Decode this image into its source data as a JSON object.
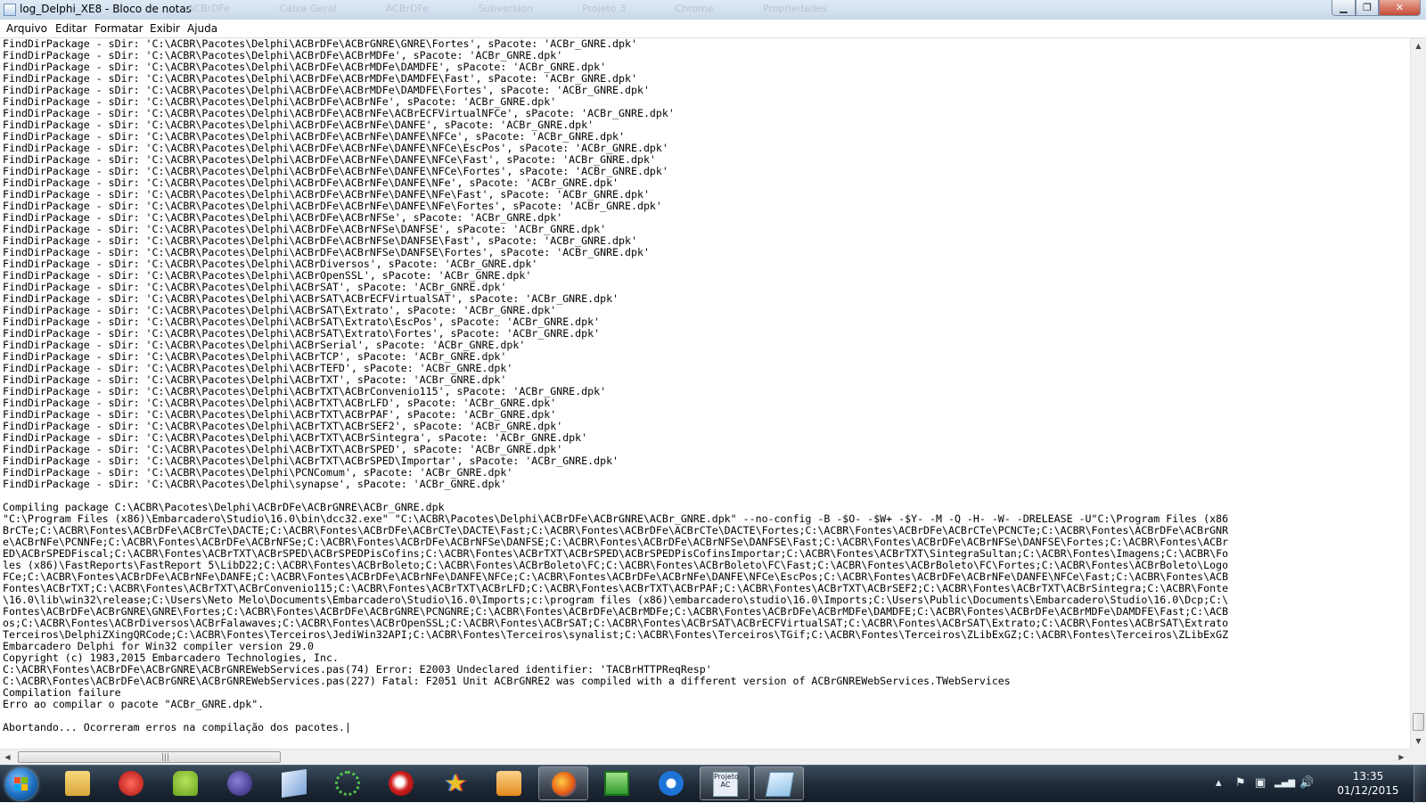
{
  "window": {
    "title": "log_Delphi_XE8 - Bloco de notas",
    "ghost_tabs": [
      "ACBrDFe",
      "Caixa Geral",
      "ACBrDFe",
      "Subversion",
      "Projeto 3",
      "Chrome",
      "Propriedades"
    ]
  },
  "window_buttons": {
    "minimize": "▁",
    "maximize": "❐",
    "close": "✕"
  },
  "menu": [
    "Arquivo",
    "Editar",
    "Formatar",
    "Exibir",
    "Ajuda"
  ],
  "content": {
    "lines": [
      "FindDirPackage - sDir: 'C:\\ACBR\\Pacotes\\Delphi\\ACBrDFe\\ACBrGNRE\\GNRE\\Fortes', sPacote: 'ACBr_GNRE.dpk'",
      "FindDirPackage - sDir: 'C:\\ACBR\\Pacotes\\Delphi\\ACBrDFe\\ACBrMDFe', sPacote: 'ACBr_GNRE.dpk'",
      "FindDirPackage - sDir: 'C:\\ACBR\\Pacotes\\Delphi\\ACBrDFe\\ACBrMDFe\\DAMDFE', sPacote: 'ACBr_GNRE.dpk'",
      "FindDirPackage - sDir: 'C:\\ACBR\\Pacotes\\Delphi\\ACBrDFe\\ACBrMDFe\\DAMDFE\\Fast', sPacote: 'ACBr_GNRE.dpk'",
      "FindDirPackage - sDir: 'C:\\ACBR\\Pacotes\\Delphi\\ACBrDFe\\ACBrMDFe\\DAMDFE\\Fortes', sPacote: 'ACBr_GNRE.dpk'",
      "FindDirPackage - sDir: 'C:\\ACBR\\Pacotes\\Delphi\\ACBrDFe\\ACBrNFe', sPacote: 'ACBr_GNRE.dpk'",
      "FindDirPackage - sDir: 'C:\\ACBR\\Pacotes\\Delphi\\ACBrDFe\\ACBrNFe\\ACBrECFVirtualNFCe', sPacote: 'ACBr_GNRE.dpk'",
      "FindDirPackage - sDir: 'C:\\ACBR\\Pacotes\\Delphi\\ACBrDFe\\ACBrNFe\\DANFE', sPacote: 'ACBr_GNRE.dpk'",
      "FindDirPackage - sDir: 'C:\\ACBR\\Pacotes\\Delphi\\ACBrDFe\\ACBrNFe\\DANFE\\NFCe', sPacote: 'ACBr_GNRE.dpk'",
      "FindDirPackage - sDir: 'C:\\ACBR\\Pacotes\\Delphi\\ACBrDFe\\ACBrNFe\\DANFE\\NFCe\\EscPos', sPacote: 'ACBr_GNRE.dpk'",
      "FindDirPackage - sDir: 'C:\\ACBR\\Pacotes\\Delphi\\ACBrDFe\\ACBrNFe\\DANFE\\NFCe\\Fast', sPacote: 'ACBr_GNRE.dpk'",
      "FindDirPackage - sDir: 'C:\\ACBR\\Pacotes\\Delphi\\ACBrDFe\\ACBrNFe\\DANFE\\NFCe\\Fortes', sPacote: 'ACBr_GNRE.dpk'",
      "FindDirPackage - sDir: 'C:\\ACBR\\Pacotes\\Delphi\\ACBrDFe\\ACBrNFe\\DANFE\\NFe', sPacote: 'ACBr_GNRE.dpk'",
      "FindDirPackage - sDir: 'C:\\ACBR\\Pacotes\\Delphi\\ACBrDFe\\ACBrNFe\\DANFE\\NFe\\Fast', sPacote: 'ACBr_GNRE.dpk'",
      "FindDirPackage - sDir: 'C:\\ACBR\\Pacotes\\Delphi\\ACBrDFe\\ACBrNFe\\DANFE\\NFe\\Fortes', sPacote: 'ACBr_GNRE.dpk'",
      "FindDirPackage - sDir: 'C:\\ACBR\\Pacotes\\Delphi\\ACBrDFe\\ACBrNFSe', sPacote: 'ACBr_GNRE.dpk'",
      "FindDirPackage - sDir: 'C:\\ACBR\\Pacotes\\Delphi\\ACBrDFe\\ACBrNFSe\\DANFSE', sPacote: 'ACBr_GNRE.dpk'",
      "FindDirPackage - sDir: 'C:\\ACBR\\Pacotes\\Delphi\\ACBrDFe\\ACBrNFSe\\DANFSE\\Fast', sPacote: 'ACBr_GNRE.dpk'",
      "FindDirPackage - sDir: 'C:\\ACBR\\Pacotes\\Delphi\\ACBrDFe\\ACBrNFSe\\DANFSE\\Fortes', sPacote: 'ACBr_GNRE.dpk'",
      "FindDirPackage - sDir: 'C:\\ACBR\\Pacotes\\Delphi\\ACBrDiversos', sPacote: 'ACBr_GNRE.dpk'",
      "FindDirPackage - sDir: 'C:\\ACBR\\Pacotes\\Delphi\\ACBrOpenSSL', sPacote: 'ACBr_GNRE.dpk'",
      "FindDirPackage - sDir: 'C:\\ACBR\\Pacotes\\Delphi\\ACBrSAT', sPacote: 'ACBr_GNRE.dpk'",
      "FindDirPackage - sDir: 'C:\\ACBR\\Pacotes\\Delphi\\ACBrSAT\\ACBrECFVirtualSAT', sPacote: 'ACBr_GNRE.dpk'",
      "FindDirPackage - sDir: 'C:\\ACBR\\Pacotes\\Delphi\\ACBrSAT\\Extrato', sPacote: 'ACBr_GNRE.dpk'",
      "FindDirPackage - sDir: 'C:\\ACBR\\Pacotes\\Delphi\\ACBrSAT\\Extrato\\EscPos', sPacote: 'ACBr_GNRE.dpk'",
      "FindDirPackage - sDir: 'C:\\ACBR\\Pacotes\\Delphi\\ACBrSAT\\Extrato\\Fortes', sPacote: 'ACBr_GNRE.dpk'",
      "FindDirPackage - sDir: 'C:\\ACBR\\Pacotes\\Delphi\\ACBrSerial', sPacote: 'ACBr_GNRE.dpk'",
      "FindDirPackage - sDir: 'C:\\ACBR\\Pacotes\\Delphi\\ACBrTCP', sPacote: 'ACBr_GNRE.dpk'",
      "FindDirPackage - sDir: 'C:\\ACBR\\Pacotes\\Delphi\\ACBrTEFD', sPacote: 'ACBr_GNRE.dpk'",
      "FindDirPackage - sDir: 'C:\\ACBR\\Pacotes\\Delphi\\ACBrTXT', sPacote: 'ACBr_GNRE.dpk'",
      "FindDirPackage - sDir: 'C:\\ACBR\\Pacotes\\Delphi\\ACBrTXT\\ACBrConvenio115', sPacote: 'ACBr_GNRE.dpk'",
      "FindDirPackage - sDir: 'C:\\ACBR\\Pacotes\\Delphi\\ACBrTXT\\ACBrLFD', sPacote: 'ACBr_GNRE.dpk'",
      "FindDirPackage - sDir: 'C:\\ACBR\\Pacotes\\Delphi\\ACBrTXT\\ACBrPAF', sPacote: 'ACBr_GNRE.dpk'",
      "FindDirPackage - sDir: 'C:\\ACBR\\Pacotes\\Delphi\\ACBrTXT\\ACBrSEF2', sPacote: 'ACBr_GNRE.dpk'",
      "FindDirPackage - sDir: 'C:\\ACBR\\Pacotes\\Delphi\\ACBrTXT\\ACBrSintegra', sPacote: 'ACBr_GNRE.dpk'",
      "FindDirPackage - sDir: 'C:\\ACBR\\Pacotes\\Delphi\\ACBrTXT\\ACBrSPED', sPacote: 'ACBr_GNRE.dpk'",
      "FindDirPackage - sDir: 'C:\\ACBR\\Pacotes\\Delphi\\ACBrTXT\\ACBrSPED\\Importar', sPacote: 'ACBr_GNRE.dpk'",
      "FindDirPackage - sDir: 'C:\\ACBR\\Pacotes\\Delphi\\PCNComum', sPacote: 'ACBr_GNRE.dpk'",
      "FindDirPackage - sDir: 'C:\\ACBR\\Pacotes\\Delphi\\synapse', sPacote: 'ACBr_GNRE.dpk'",
      "",
      "Compiling package C:\\ACBR\\Pacotes\\Delphi\\ACBrDFe\\ACBrGNRE\\ACBr_GNRE.dpk",
      "\"C:\\Program Files (x86)\\Embarcadero\\Studio\\16.0\\bin\\dcc32.exe\" \"C:\\ACBR\\Pacotes\\Delphi\\ACBrDFe\\ACBrGNRE\\ACBr_GNRE.dpk\" --no-config -B -$O- -$W+ -$Y- -M -Q -H- -W- -DRELEASE -U\"C:\\Program Files (x86",
      "BrCTe;C:\\ACBR\\Fontes\\ACBrDFe\\ACBrCTe\\DACTE;C:\\ACBR\\Fontes\\ACBrDFe\\ACBrCTe\\DACTE\\Fast;C:\\ACBR\\Fontes\\ACBrDFe\\ACBrCTe\\DACTE\\Fortes;C:\\ACBR\\Fontes\\ACBrDFe\\ACBrCTe\\PCNCTe;C:\\ACBR\\Fontes\\ACBrDFe\\ACBrGNR",
      "e\\ACBrNFe\\PCNNFe;C:\\ACBR\\Fontes\\ACBrDFe\\ACBrNFSe;C:\\ACBR\\Fontes\\ACBrDFe\\ACBrNFSe\\DANFSE;C:\\ACBR\\Fontes\\ACBrDFe\\ACBrNFSe\\DANFSE\\Fast;C:\\ACBR\\Fontes\\ACBrDFe\\ACBrNFSe\\DANFSE\\Fortes;C:\\ACBR\\Fontes\\ACBr",
      "ED\\ACBrSPEDFiscal;C:\\ACBR\\Fontes\\ACBrTXT\\ACBrSPED\\ACBrSPEDPisCofins;C:\\ACBR\\Fontes\\ACBrTXT\\ACBrSPED\\ACBrSPEDPisCofinsImportar;C:\\ACBR\\Fontes\\ACBrTXT\\SintegraSultan;C:\\ACBR\\Fontes\\Imagens;C:\\ACBR\\Fo",
      "les (x86)\\FastReports\\FastReport 5\\LibD22;C:\\ACBR\\Fontes\\ACBrBoleto;C:\\ACBR\\Fontes\\ACBrBoleto\\FC;C:\\ACBR\\Fontes\\ACBrBoleto\\FC\\Fast;C:\\ACBR\\Fontes\\ACBrBoleto\\FC\\Fortes;C:\\ACBR\\Fontes\\ACBrBoleto\\Logo",
      "FCe;C:\\ACBR\\Fontes\\ACBrDFe\\ACBrNFe\\DANFE;C:\\ACBR\\Fontes\\ACBrDFe\\ACBrNFe\\DANFE\\NFCe;C:\\ACBR\\Fontes\\ACBrDFe\\ACBrNFe\\DANFE\\NFCe\\EscPos;C:\\ACBR\\Fontes\\ACBrDFe\\ACBrNFe\\DANFE\\NFCe\\Fast;C:\\ACBR\\Fontes\\ACB",
      "Fontes\\ACBrTXT;C:\\ACBR\\Fontes\\ACBrTXT\\ACBrConvenio115;C:\\ACBR\\Fontes\\ACBrTXT\\ACBrLFD;C:\\ACBR\\Fontes\\ACBrTXT\\ACBrPAF;C:\\ACBR\\Fontes\\ACBrTXT\\ACBrSEF2;C:\\ACBR\\Fontes\\ACBrTXT\\ACBrSintegra;C:\\ACBR\\Fonte",
      "\\16.0\\lib\\win32\\release;C:\\Users\\Neto Melo\\Documents\\Embarcadero\\Studio\\16.0\\Imports;c:\\program files (x86)\\embarcadero\\studio\\16.0\\Imports;C:\\Users\\Public\\Documents\\Embarcadero\\Studio\\16.0\\Dcp;C:\\",
      "Fontes\\ACBrDFe\\ACBrGNRE\\GNRE\\Fortes;C:\\ACBR\\Fontes\\ACBrDFe\\ACBrGNRE\\PCNGNRE;C:\\ACBR\\Fontes\\ACBrDFe\\ACBrMDFe;C:\\ACBR\\Fontes\\ACBrDFe\\ACBrMDFe\\DAMDFE;C:\\ACBR\\Fontes\\ACBrDFe\\ACBrMDFe\\DAMDFE\\Fast;C:\\ACB",
      "os;C:\\ACBR\\Fontes\\ACBrDiversos\\ACBrFalawaves;C:\\ACBR\\Fontes\\ACBrOpenSSL;C:\\ACBR\\Fontes\\ACBrSAT;C:\\ACBR\\Fontes\\ACBrSAT\\ACBrECFVirtualSAT;C:\\ACBR\\Fontes\\ACBrSAT\\Extrato;C:\\ACBR\\Fontes\\ACBrSAT\\Extrato",
      "Terceiros\\DelphiZXingQRCode;C:\\ACBR\\Fontes\\Terceiros\\JediWin32API;C:\\ACBR\\Fontes\\Terceiros\\synalist;C:\\ACBR\\Fontes\\Terceiros\\TGif;C:\\ACBR\\Fontes\\Terceiros\\ZLibExGZ;C:\\ACBR\\Fontes\\Terceiros\\ZLibExGZ",
      "Embarcadero Delphi for Win32 compiler version 29.0",
      "Copyright (c) 1983,2015 Embarcadero Technologies, Inc.",
      "C:\\ACBR\\Fontes\\ACBrDFe\\ACBrGNRE\\ACBrGNREWebServices.pas(74) Error: E2003 Undeclared identifier: 'TACBrHTTPReqResp'",
      "C:\\ACBR\\Fontes\\ACBrDFe\\ACBrGNRE\\ACBrGNREWebServices.pas(227) Fatal: F2051 Unit ACBrGNRE2 was compiled with a different version of ACBrGNREWebServices.TWebServices",
      "Compilation failure",
      "Erro ao compilar o pacote \"ACBr_GNRE.dpk\".",
      "",
      "Abortando... Ocorreram erros na compilação dos pacotes.|"
    ]
  },
  "scrollbars": {
    "up": "▲",
    "down": "▼",
    "left": "◀",
    "right": "▶",
    "grip": "|||"
  },
  "taskbar": {
    "apps": [
      {
        "name": "windows-explorer",
        "label": ""
      },
      {
        "name": "delphi-xe8",
        "label": ""
      },
      {
        "name": "android",
        "label": ""
      },
      {
        "name": "eclipse",
        "label": ""
      },
      {
        "name": "virtualbox",
        "label": ""
      },
      {
        "name": "ibexpert",
        "label": ""
      },
      {
        "name": "delphi-red",
        "label": ""
      },
      {
        "name": "star-app",
        "label": ""
      },
      {
        "name": "media-player",
        "label": ""
      },
      {
        "name": "firefox",
        "label": ""
      },
      {
        "name": "excel-like",
        "label": ""
      },
      {
        "name": "teamviewer",
        "label": ""
      },
      {
        "name": "projeto-acbr",
        "label": "Projeto AC"
      },
      {
        "name": "notepad",
        "label": ""
      }
    ],
    "tray_icons": [
      "▴",
      "⚑",
      "▣",
      "▂▄▆",
      "🔊"
    ],
    "time": "13:35",
    "date": "01/12/2015"
  },
  "colors": {
    "taskbar_bg": "#1e2a38",
    "titlebar_bg": "#c9d8ea",
    "close_button": "#c44a32",
    "editor_bg": "#ffffff",
    "text": "#000000"
  }
}
